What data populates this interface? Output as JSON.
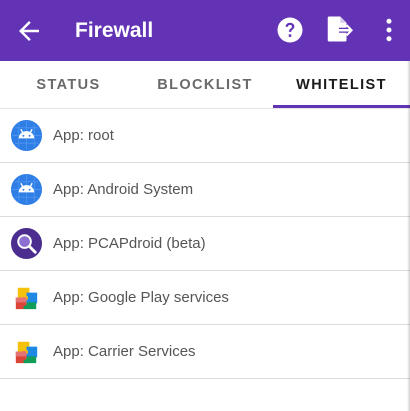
{
  "appbar": {
    "title": "Firewall",
    "background_color": "#6234b5",
    "icons": [
      "back-arrow-icon",
      "help-icon",
      "export-icon",
      "more-vertical-icon"
    ]
  },
  "tabs": [
    {
      "label": "STATUS",
      "selected": false
    },
    {
      "label": "BLOCKLIST",
      "selected": false
    },
    {
      "label": "WHITELIST",
      "selected": true
    }
  ],
  "whitelist": [
    {
      "label": "App: root",
      "icon": "android-icon"
    },
    {
      "label": "App: Android System",
      "icon": "android-icon"
    },
    {
      "label": "App: PCAPdroid (beta)",
      "icon": "pcapdroid-icon"
    },
    {
      "label": "App: Google Play services",
      "icon": "play-services-icon"
    },
    {
      "label": "App: Carrier Services",
      "icon": "play-services-icon"
    }
  ]
}
